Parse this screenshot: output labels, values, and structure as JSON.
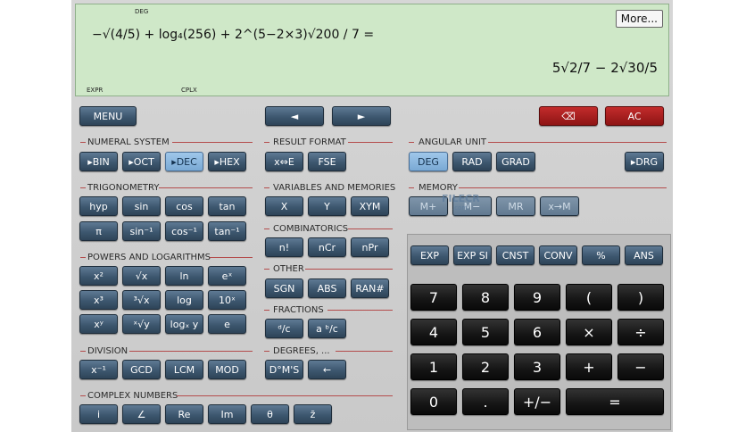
{
  "display": {
    "deg": "DEG",
    "expr_label": "EXPR",
    "cplx_label": "CPLX",
    "more": "More...",
    "expression_text": "−√(4/5) + log₄(256) + 2^(5−2×3)√200 / 7 =",
    "result_text": "5√2/7 − 2√30/5"
  },
  "top_bar": {
    "menu": "MENU",
    "left": "◄",
    "right": "►",
    "backspace": "⌫",
    "ac": "AC"
  },
  "sections": {
    "numeral_system": {
      "label": "NUMERAL SYSTEM",
      "buttons": [
        "▸BIN",
        "▸OCT",
        "▸DEC",
        "▸HEX"
      ]
    },
    "result_format": {
      "label": "RESULT FORMAT",
      "buttons": [
        "x⇔E",
        "FSE"
      ]
    },
    "angular_unit": {
      "label": "ANGULAR UNIT",
      "buttons": [
        "DEG",
        "RAD",
        "GRAD",
        "▸DRG"
      ]
    },
    "trigonometry": {
      "label": "TRIGONOMETRY",
      "buttons": [
        "hyp",
        "sin",
        "cos",
        "tan",
        "π",
        "sin⁻¹",
        "cos⁻¹",
        "tan⁻¹"
      ]
    },
    "variables": {
      "label": "VARIABLES AND MEMORIES",
      "buttons": [
        "X",
        "Y",
        "XYM"
      ]
    },
    "memory": {
      "label": "MEMORY",
      "buttons": [
        "M+",
        "M−",
        "MR",
        "x→M"
      ]
    },
    "combinatorics": {
      "label": "COMBINATORICS",
      "buttons": [
        "n!",
        "nCr",
        "nPr"
      ]
    },
    "powers": {
      "label": "POWERS AND LOGARITHMS",
      "buttons": [
        "x²",
        "√x",
        "ln",
        "eˣ",
        "x³",
        "³√x",
        "log",
        "10ˣ",
        "xʸ",
        "ˣ√y",
        "logₓ y",
        "e"
      ]
    },
    "other": {
      "label": "OTHER",
      "buttons": [
        "SGN",
        "ABS",
        "RAN#"
      ]
    },
    "fractions": {
      "label": "FRACTIONS",
      "buttons": [
        "ᵈ/c",
        "a ᵇ/c"
      ]
    },
    "division": {
      "label": "DIVISION",
      "buttons": [
        "x⁻¹",
        "GCD",
        "LCM",
        "MOD"
      ]
    },
    "degrees": {
      "label": "DEGREES, ...",
      "buttons": [
        "D°M'S",
        "←"
      ]
    },
    "complex": {
      "label": "COMPLEX NUMBERS",
      "buttons": [
        "i",
        "∠",
        "Re",
        "Im",
        "θ",
        "z̄"
      ]
    }
  },
  "function_row": [
    "EXP",
    "EXP SI",
    "CNST",
    "CONV",
    "%",
    "ANS"
  ],
  "keypad": [
    "7",
    "8",
    "9",
    "(",
    ")",
    "4",
    "5",
    "6",
    "×",
    "÷",
    "1",
    "2",
    "3",
    "+",
    "−",
    "0",
    ".",
    "+/−",
    "="
  ],
  "watermark": "FILECR",
  "watermark_sub": ".com",
  "colors": {
    "display_bg": "#cfe8c8",
    "button": "#3d576f",
    "active": "#9fc7ea",
    "ac": "#8e1414",
    "section_line": "#b44c4c"
  }
}
